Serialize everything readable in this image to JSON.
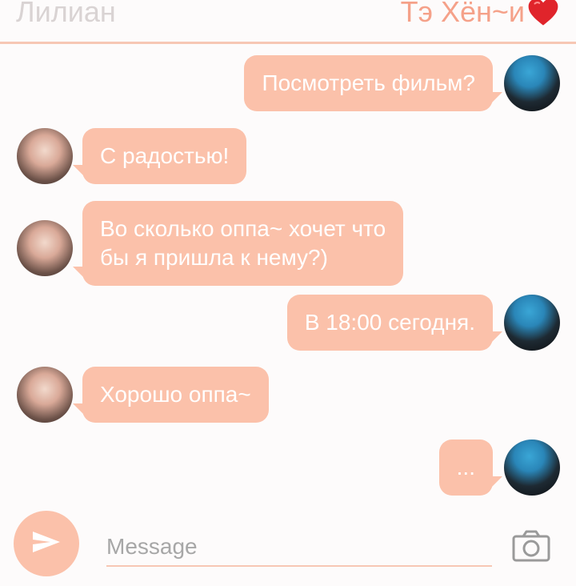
{
  "header": {
    "contact_left": "Лилиан",
    "contact_right": "Тэ Хён~и"
  },
  "messages": [
    {
      "from": "him",
      "text": "Посмотреть фильм?"
    },
    {
      "from": "her",
      "text": "С радостью!"
    },
    {
      "from": "her",
      "line1": "Во сколько оппа~ хочет что",
      "line2": "бы я пришла к нему?)"
    },
    {
      "from": "him",
      "text": "В 18:00 сегодня."
    },
    {
      "from": "her",
      "text": "Хорошо оппа~"
    },
    {
      "from": "him",
      "text": "..."
    }
  ],
  "composer": {
    "placeholder": "Message"
  },
  "icons": {
    "send": "send-icon",
    "camera": "camera-icon",
    "heart": "heart-icon"
  },
  "colors": {
    "bubble": "#fbc1aa",
    "accent": "#f5a189",
    "heart": "#e0242b"
  }
}
